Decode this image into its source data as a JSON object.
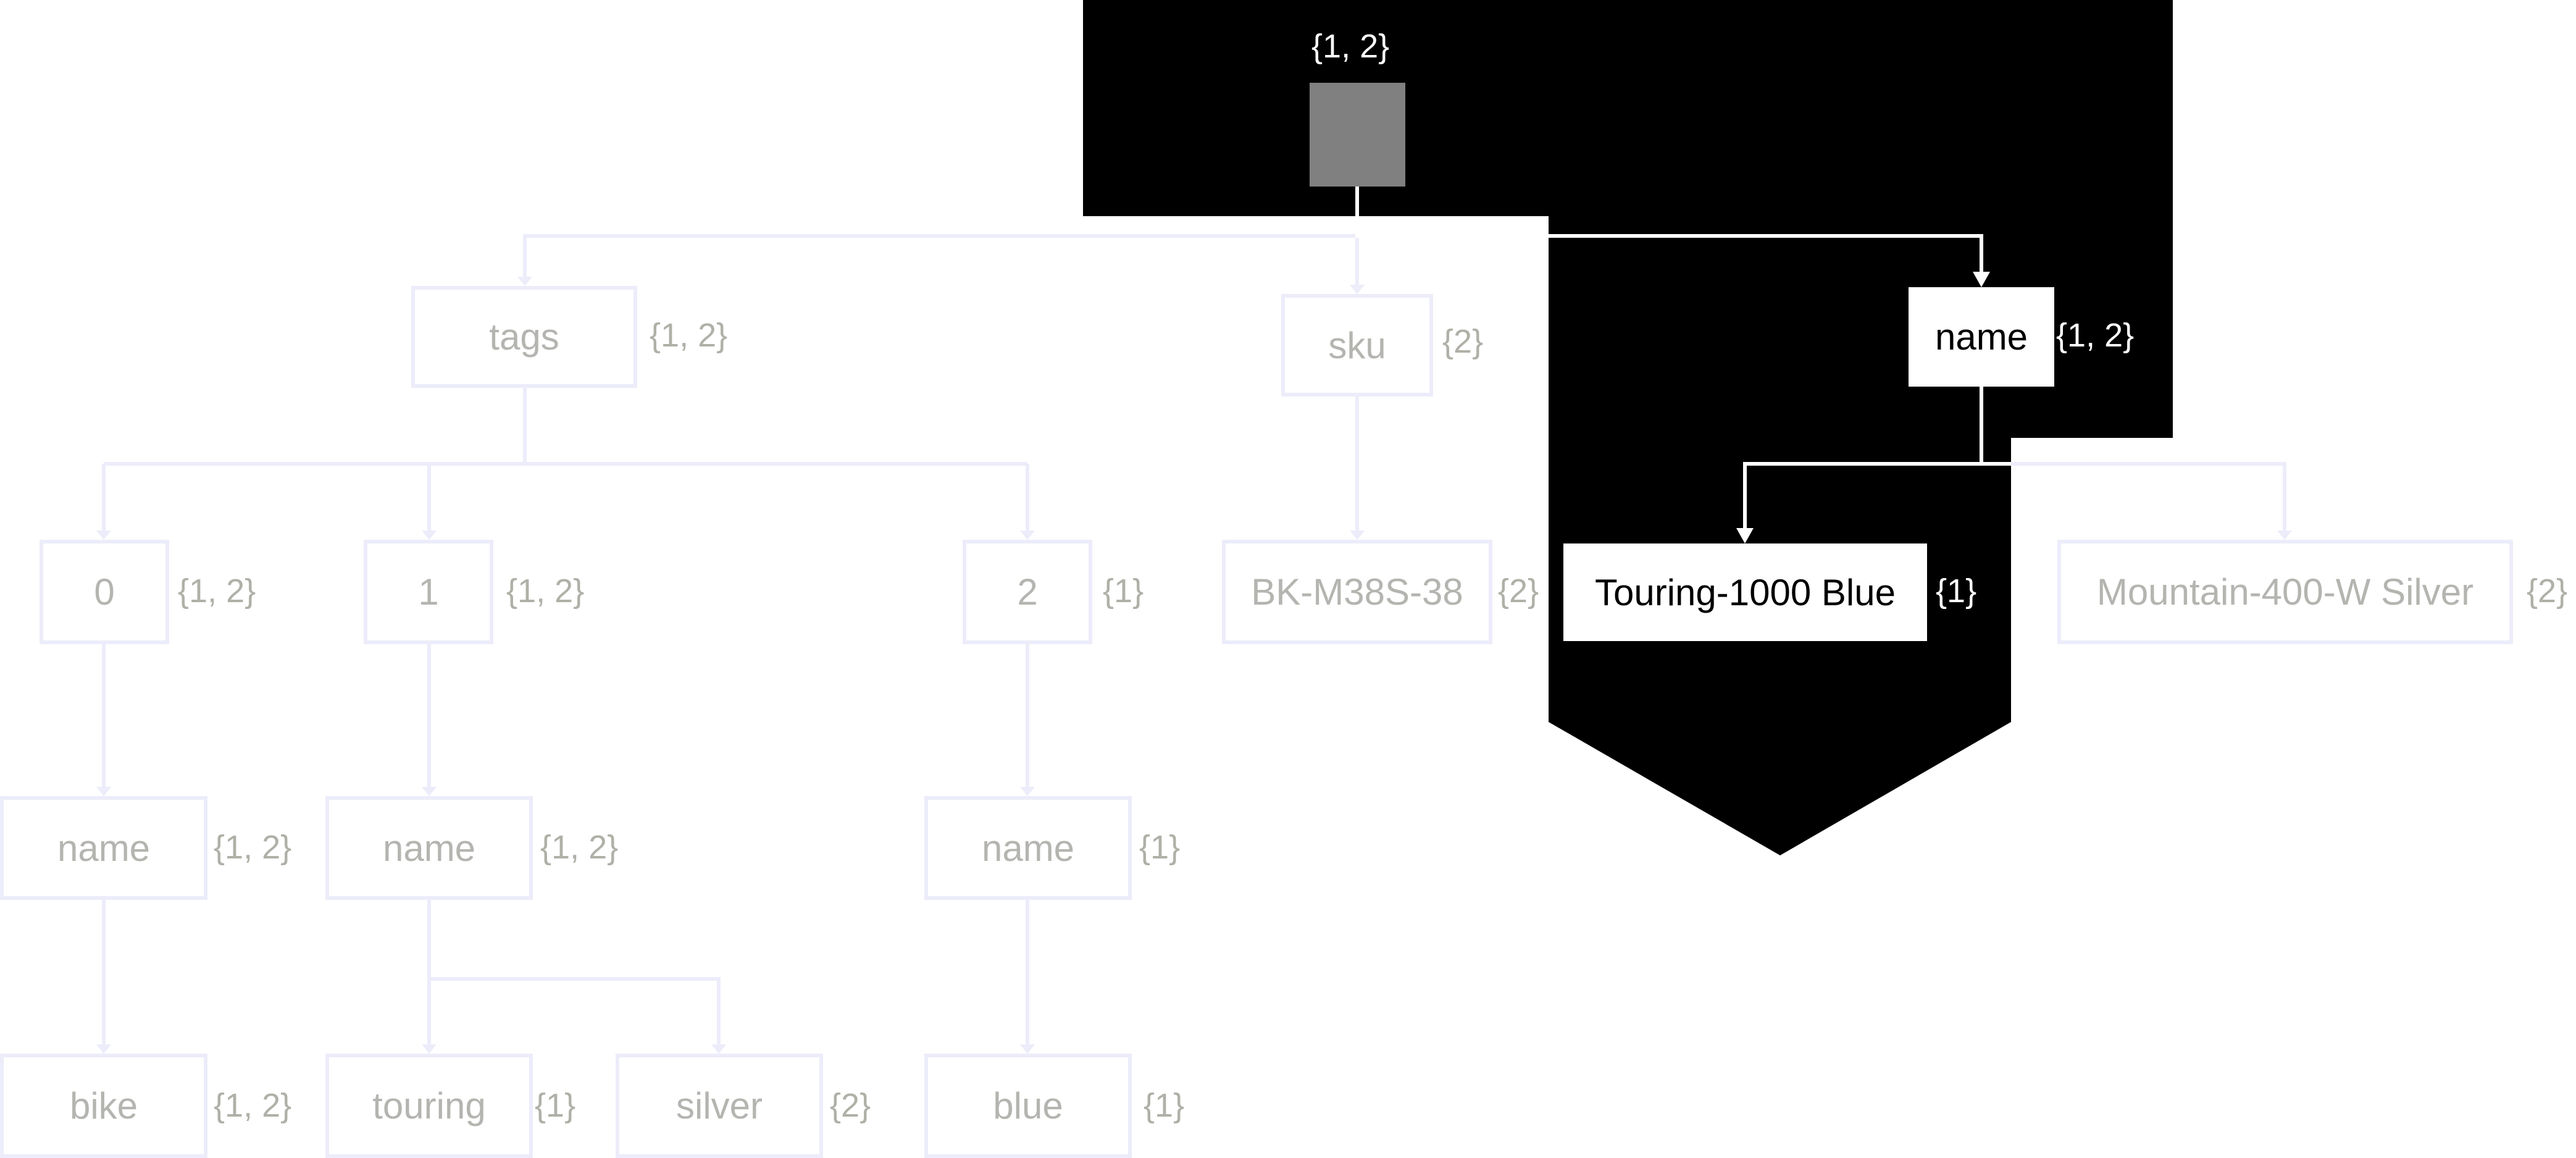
{
  "diagram": {
    "type": "json-tree-overlay",
    "highlight_path": [
      "root",
      "name",
      "Touring-1000 Blue"
    ],
    "colors": {
      "background": "#ffffff",
      "mask": "#000000",
      "dim_edge": "#ececfa",
      "dim_text": "#b4b4b0",
      "highlight_edge": "#ffffff",
      "highlight_text": "#000000",
      "root_fill": "#808080"
    },
    "root": {
      "label": "",
      "sets": "{1, 2}"
    },
    "nodes": {
      "tags": {
        "label": "tags",
        "sets": "{1, 2}"
      },
      "sku": {
        "label": "sku",
        "sets": "{2}"
      },
      "name": {
        "label": "name",
        "sets": "{1, 2}"
      },
      "t0": {
        "label": "0",
        "sets": "{1, 2}"
      },
      "t1": {
        "label": "1",
        "sets": "{1, 2}"
      },
      "t2": {
        "label": "2",
        "sets": "{1}"
      },
      "sku_val": {
        "label": "BK-M38S-38",
        "sets": "{2}"
      },
      "name_v1": {
        "label": "Touring-1000 Blue",
        "sets": "{1}"
      },
      "name_v2": {
        "label": "Mountain-400-W Silver",
        "sets": "{2}"
      },
      "t0_name": {
        "label": "name",
        "sets": "{1, 2}"
      },
      "t1_name": {
        "label": "name",
        "sets": "{1, 2}"
      },
      "t2_name": {
        "label": "name",
        "sets": "{1}"
      },
      "t0_v": {
        "label": "bike",
        "sets": "{1, 2}"
      },
      "t1_v1": {
        "label": "touring",
        "sets": "{1}"
      },
      "t1_v2": {
        "label": "silver",
        "sets": "{2}"
      },
      "t2_v": {
        "label": "blue",
        "sets": "{1}"
      }
    }
  }
}
